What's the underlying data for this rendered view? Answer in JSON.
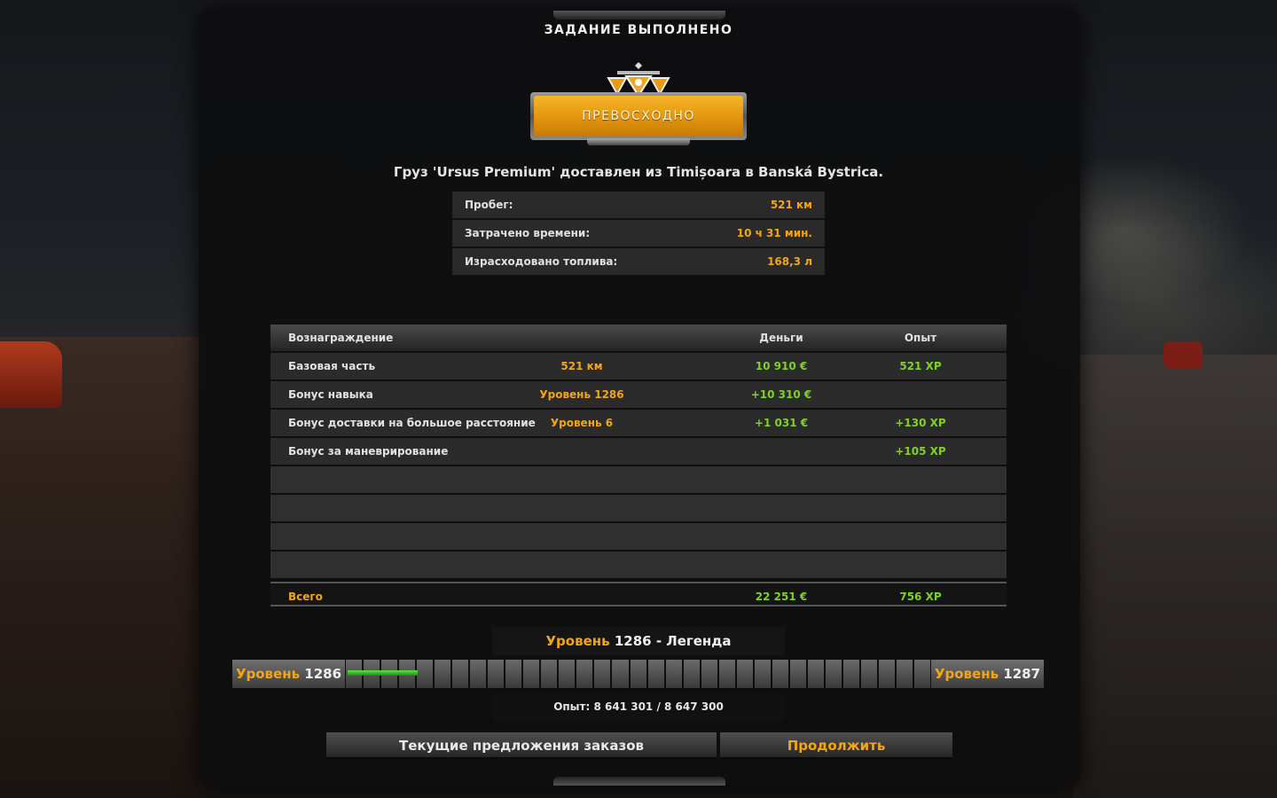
{
  "window": {
    "title": "ЗАДАНИЕ ВЫПОЛНЕНО"
  },
  "rating": {
    "label": "ПРЕВОСХОДНО",
    "accent": "#e89b10"
  },
  "cargo_line": "Груз 'Ursus Premium' доставлен из Timișoara в Banská Bystrica.",
  "stats": [
    {
      "label": "Пробег:",
      "value": "521 км"
    },
    {
      "label": "Затрачено времени:",
      "value": "10 ч 31 мин."
    },
    {
      "label": "Израсходовано топлива:",
      "value": "168,3 л"
    }
  ],
  "rewards": {
    "headers": {
      "name": "Вознаграждение",
      "money": "Деньги",
      "xp": "Опыт"
    },
    "rows": [
      {
        "name": "Базовая часть",
        "mid": "521 км",
        "money": "10 910 €",
        "xp": "521 XP"
      },
      {
        "name": "Бонус навыка",
        "mid": "Уровень 1286",
        "money": "+10 310 €",
        "xp": ""
      },
      {
        "name": "Бонус доставки на большое расстояние",
        "mid": "Уровень 6",
        "money": "+1 031 €",
        "xp": "+130 XP"
      },
      {
        "name": "Бонус за маневрирование",
        "mid": "",
        "money": "",
        "xp": "+105 XP"
      }
    ],
    "empty_rows": 4,
    "total": {
      "name": "Всего",
      "money": "22 251 €",
      "xp": "756 XP"
    }
  },
  "level": {
    "title_prefix": "Уровень",
    "title_number": "1286",
    "title_suffix": "- Легенда",
    "current_label": "Уровень",
    "current_number": "1286",
    "next_label": "Уровень",
    "next_number": "1287",
    "progress_fraction": 0.12,
    "experience_text": "Опыт: 8 641 301 / 8 647 300"
  },
  "buttons": {
    "offers": "Текущие предложения заказов",
    "continue": "Продолжить"
  },
  "colors": {
    "accent_orange": "#f2a614",
    "xp_green": "#7ed321"
  }
}
